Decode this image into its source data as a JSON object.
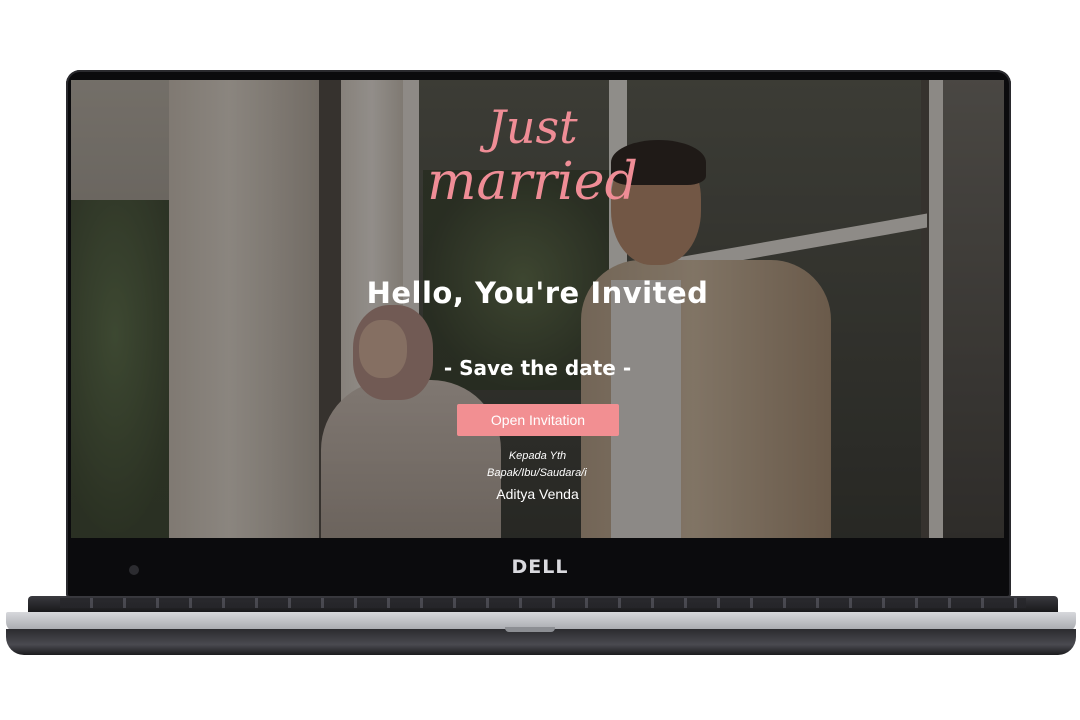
{
  "device": {
    "brand_logo": "DELL"
  },
  "invitation": {
    "logo_line1": "Just",
    "logo_line2": "married",
    "heading": "Hello, You're Invited",
    "subheading": "- Save the date -",
    "open_button_label": "Open Invitation",
    "greeting": "Kepada Yth",
    "salutation": "Bapak/Ibu/Saudara/i",
    "guest_name": "Aditya Venda"
  },
  "colors": {
    "accent": "#f28f92",
    "logo": "#ef8d96",
    "text": "#ffffff"
  }
}
